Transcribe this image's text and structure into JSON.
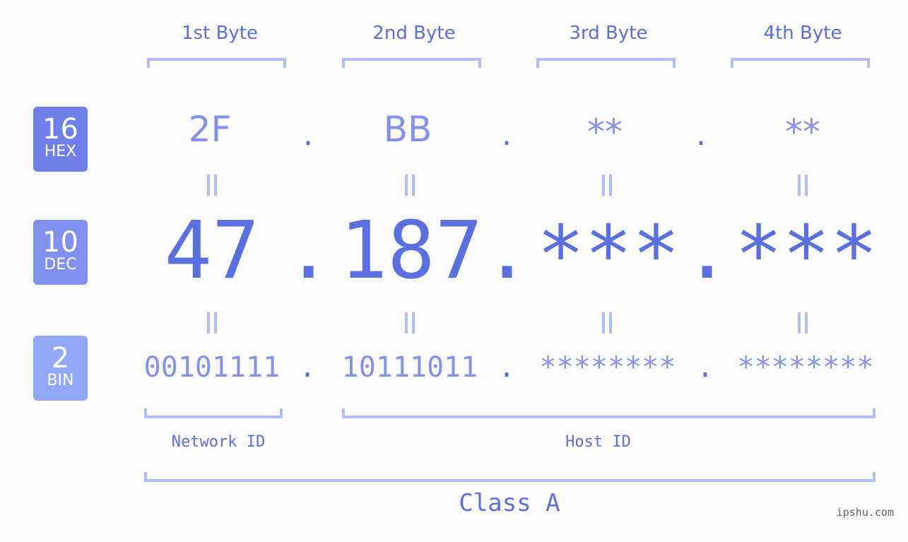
{
  "bytes": {
    "headers": [
      "1st Byte",
      "2nd Byte",
      "3rd Byte",
      "4th Byte"
    ]
  },
  "badges": {
    "hex": {
      "base": "16",
      "label": "HEX",
      "color": "#7080ea"
    },
    "dec": {
      "base": "10",
      "label": "DEC",
      "color": "#8090ee"
    },
    "bin": {
      "base": "2",
      "label": "BIN",
      "color": "#90a8f6"
    }
  },
  "hex": {
    "octets": [
      "2F",
      "BB",
      "**",
      "**"
    ],
    "separator": "."
  },
  "dec": {
    "octets": [
      "47",
      "187",
      "***",
      "***"
    ],
    "separator": "."
  },
  "bin": {
    "octets": [
      "00101111",
      "10111011",
      "********",
      "********"
    ],
    "separator": "."
  },
  "segments": {
    "network_label": "Network ID",
    "host_label": "Host ID",
    "class_label": "Class A"
  },
  "colors": {
    "accent": "#5a6fe0",
    "light_accent": "#8492ec",
    "bracket": "#b3bcf6",
    "background": "#fbfcfb"
  },
  "watermark": "ipshu.com"
}
